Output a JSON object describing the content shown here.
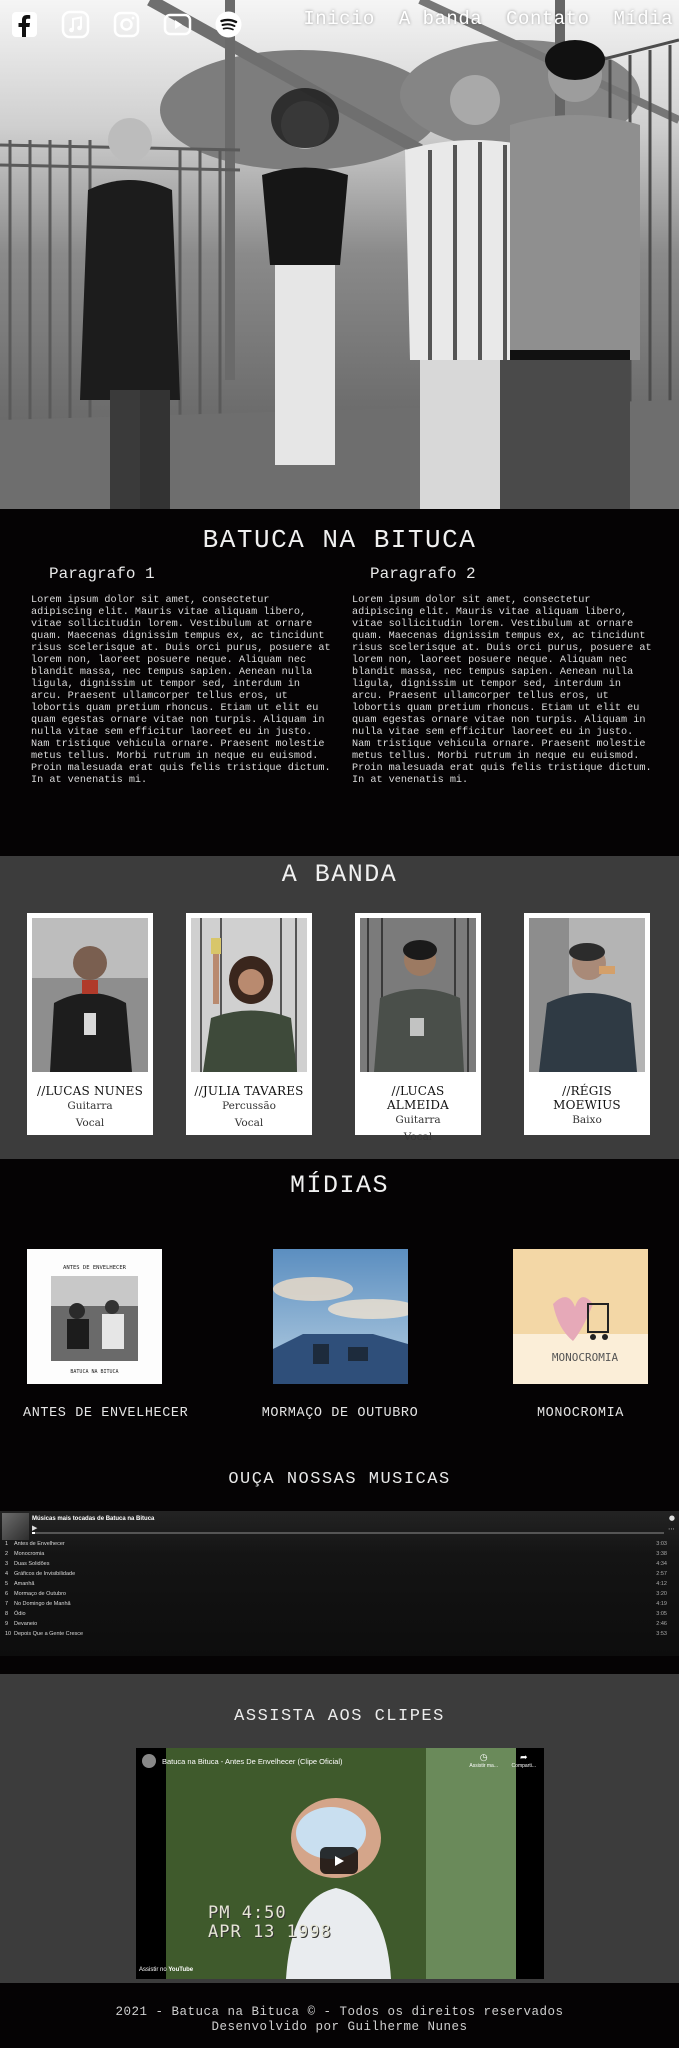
{
  "social": [
    {
      "name": "facebook-icon"
    },
    {
      "name": "music-icon"
    },
    {
      "name": "instagram-icon"
    },
    {
      "name": "youtube-icon"
    },
    {
      "name": "spotify-icon"
    }
  ],
  "nav": {
    "items": [
      "Inicio",
      "A banda",
      "Contato",
      "Mídia"
    ]
  },
  "about": {
    "title": "BATUCA NA BITUCA",
    "paragraphs": [
      {
        "heading": "Paragrafo 1",
        "text": "Lorem ipsum dolor sit amet, consectetur adipiscing elit. Mauris vitae aliquam libero, vitae sollicitudin lorem. Vestibulum at ornare quam. Maecenas dignissim tempus ex, ac tincidunt risus scelerisque at. Duis orci purus, posuere at lorem non, laoreet posuere neque. Aliquam nec blandit massa, nec tempus sapien. Aenean nulla ligula, dignissim ut tempor sed, interdum in arcu. Praesent ullamcorper tellus eros, ut lobortis quam pretium rhoncus. Etiam ut elit eu quam egestas ornare vitae non turpis. Aliquam in nulla vitae sem efficitur laoreet eu in justo. Nam tristique vehicula ornare. Praesent molestie metus tellus. Morbi rutrum in neque eu euismod. Proin malesuada erat quis felis tristique dictum. In at venenatis mi."
      },
      {
        "heading": "Paragrafo 2",
        "text": "Lorem ipsum dolor sit amet, consectetur adipiscing elit. Mauris vitae aliquam libero, vitae sollicitudin lorem. Vestibulum at ornare quam. Maecenas dignissim tempus ex, ac tincidunt risus scelerisque at. Duis orci purus, posuere at lorem non, laoreet posuere neque. Aliquam nec blandit massa, nec tempus sapien. Aenean nulla ligula, dignissim ut tempor sed, interdum in arcu. Praesent ullamcorper tellus eros, ut lobortis quam pretium rhoncus. Etiam ut elit eu quam egestas ornare vitae non turpis. Aliquam in nulla vitae sem efficitur laoreet eu in justo. Nam tristique vehicula ornare. Praesent molestie metus tellus. Morbi rutrum in neque eu euismod. Proin malesuada erat quis felis tristique dictum. In at venenatis mi."
      }
    ]
  },
  "banda": {
    "title": "A BANDA",
    "members": [
      {
        "name": "//LUCAS NUNES",
        "role1": "Guitarra",
        "role2": "Vocal"
      },
      {
        "name": "//JULIA TAVARES",
        "role1": "Percussão",
        "role2": "Vocal"
      },
      {
        "name": "//LUCAS ALMEIDA",
        "role1": "Guitarra",
        "role2": "Vocal"
      },
      {
        "name": "//RÉGIS MOEWIUS",
        "role1": "Baixo",
        "role2": ""
      }
    ]
  },
  "midias": {
    "title": "MÍDIAS",
    "albums": [
      {
        "title": "ANTES DE ENVELHECER",
        "cover_text_top": "ANTES DE ENVELHECER",
        "cover_text_bottom": "BATUCA NA BITUCA"
      },
      {
        "title": "MORMAÇO DE OUTUBRO"
      },
      {
        "title": "MONOCROMIA",
        "cover_text": "MONOCROMIA"
      }
    ]
  },
  "ouca": {
    "title": "OUÇA NOSSAS MUSICAS",
    "player_title": "Músicas mais tocadas de Batuca na Bituca",
    "tracks": [
      {
        "num": "1",
        "name": "Antes de Envelhecer",
        "dur": "3:03"
      },
      {
        "num": "2",
        "name": "Monocromia",
        "dur": "3:38"
      },
      {
        "num": "3",
        "name": "Duas Solidões",
        "dur": "4:34"
      },
      {
        "num": "4",
        "name": "Gráficos de Invisibilidade",
        "dur": "2:57"
      },
      {
        "num": "5",
        "name": "Amanhã",
        "dur": "4:12"
      },
      {
        "num": "6",
        "name": "Mormaço de Outubro",
        "dur": "3:20"
      },
      {
        "num": "7",
        "name": "No Domingo de Manhã",
        "dur": "4:19"
      },
      {
        "num": "8",
        "name": "Ódio",
        "dur": "3:05"
      },
      {
        "num": "9",
        "name": "Devaneio",
        "dur": "2:46"
      },
      {
        "num": "10",
        "name": "Depois Que a Gente Cresce",
        "dur": "3:53"
      }
    ]
  },
  "clipes": {
    "title": "ASSISTA AOS CLIPES",
    "video_title": "Batuca na Bituca - Antes De Envelhecer (Clipe Oficial)",
    "watch_later": "Assistir ma...",
    "share": "Comparti...",
    "stamp_time": "PM 4:50",
    "stamp_date": "APR 13 1998",
    "watch_on": "Assistir no",
    "youtube": "YouTube"
  },
  "footer": {
    "line1": "2021 - Batuca na Bituca © - Todos os direitos reservados",
    "line2": "Desenvolvido por Guilherme Nunes"
  },
  "colors": {
    "page_bg": "#050304",
    "section_gray": "#3c3c3c",
    "card_bg": "#ffffff",
    "spotify_green": "#1db954"
  }
}
